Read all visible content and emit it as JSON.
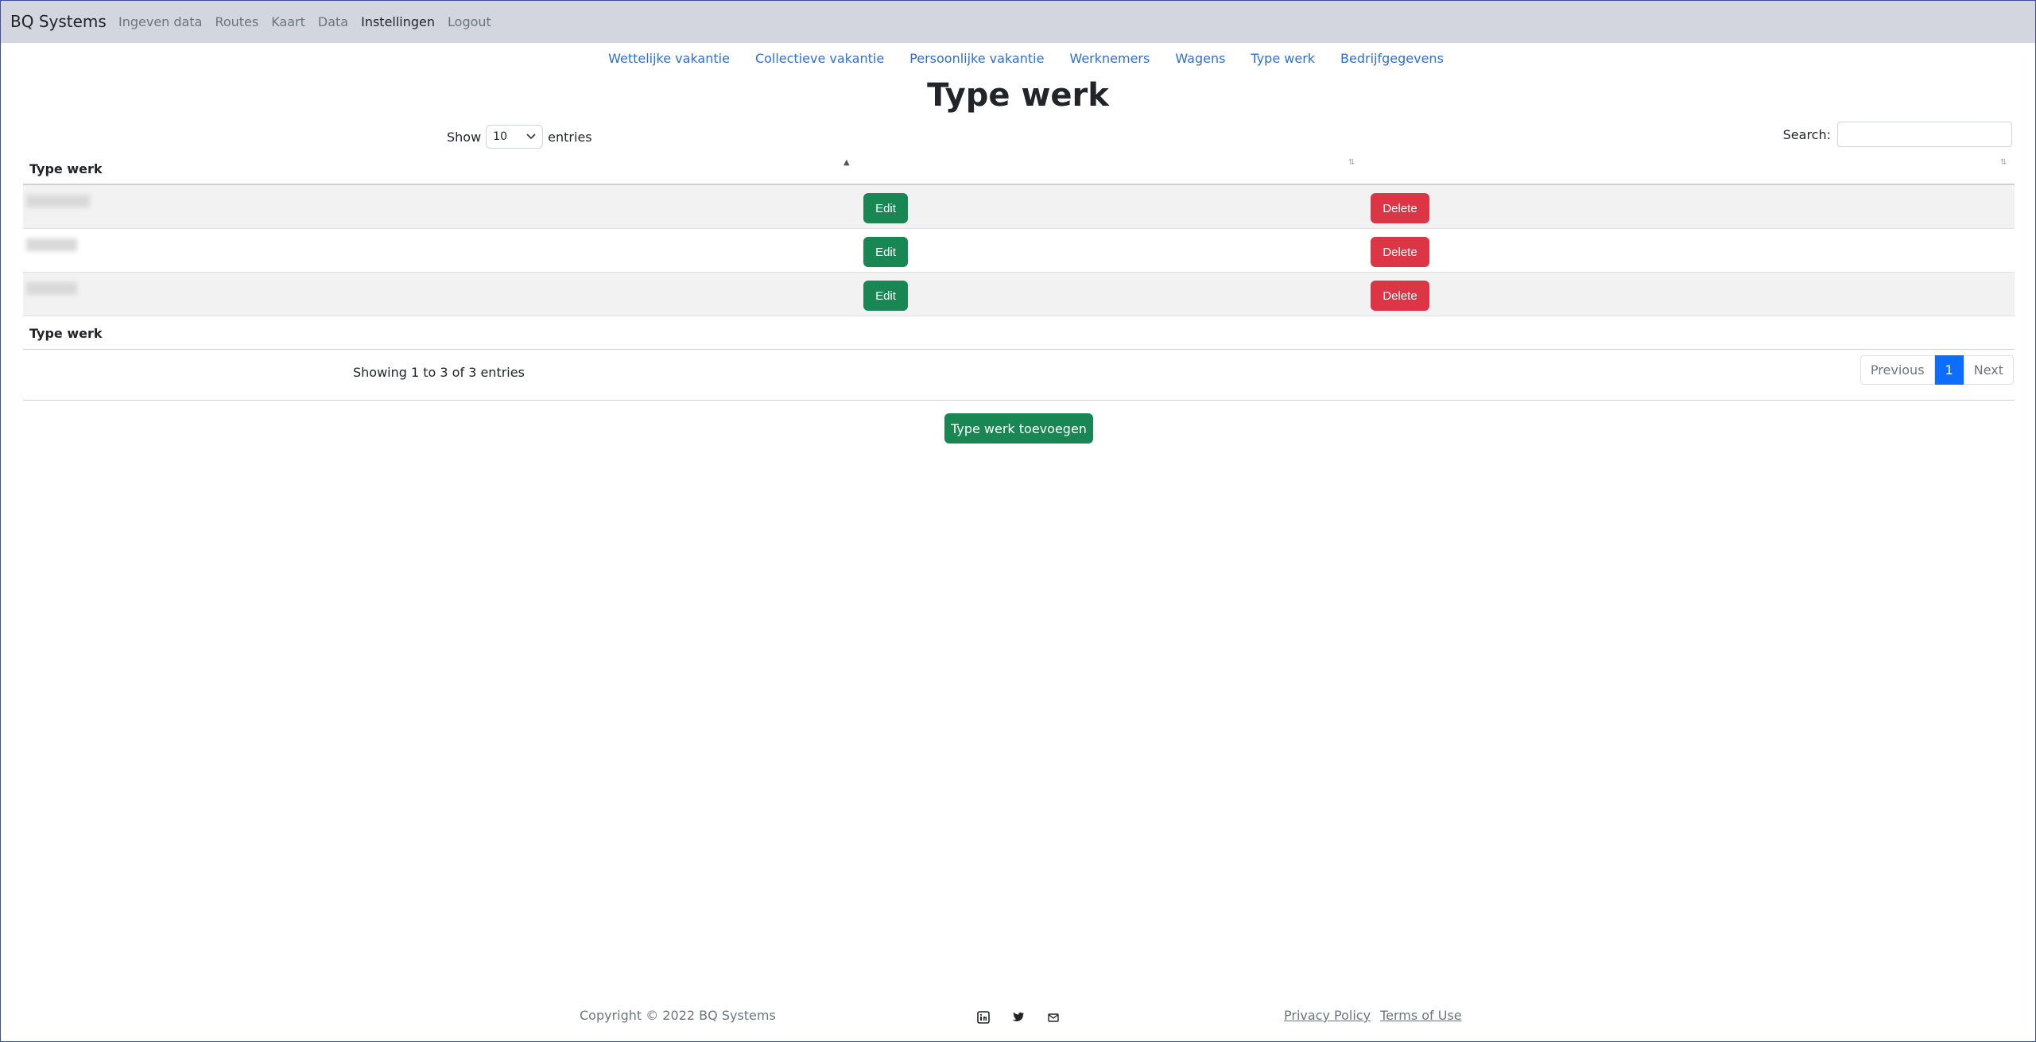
{
  "navbar": {
    "brand": "BQ Systems",
    "links": [
      "Ingeven data",
      "Routes",
      "Kaart",
      "Data",
      "Instellingen",
      "Logout"
    ]
  },
  "subnav": [
    "Wettelijke vakantie",
    "Collectieve vakantie",
    "Persoonlijke vakantie",
    "Werknemers",
    "Wagens",
    "Type werk",
    "Bedrijfgegevens"
  ],
  "page": {
    "title": "Type werk"
  },
  "table": {
    "length_prefix": "Show",
    "length_value": "10",
    "length_suffix": "entries",
    "search_label": "Search:",
    "header": "Type werk",
    "footer": "Type werk",
    "edit_label": "Edit",
    "delete_label": "Delete",
    "info": "Showing 1 to 3 of 3 entries",
    "pager": {
      "previous": "Previous",
      "current": "1",
      "next": "Next"
    }
  },
  "actions": {
    "add_label": "Type werk toevoegen"
  },
  "footer": {
    "copyright": "Copyright © 2022 BQ Systems",
    "links": [
      "Privacy Policy",
      "Terms of Use"
    ],
    "social_icons": [
      "linkedin-icon",
      "twitter-icon",
      "mail-icon"
    ]
  },
  "colors": {
    "primary": "#0d6efd",
    "success": "#198754",
    "danger": "#dc3545",
    "link": "#2a6fd6",
    "navbar": "#d3d6de"
  }
}
